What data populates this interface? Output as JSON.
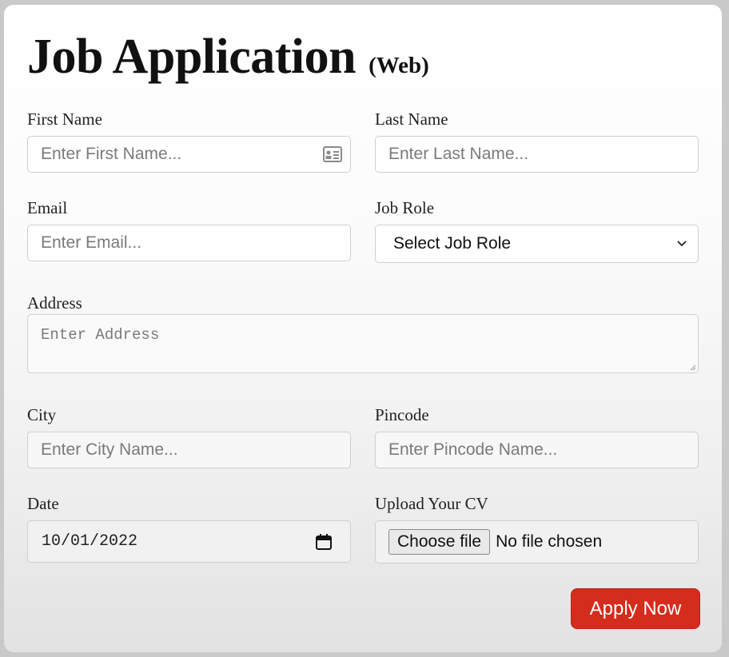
{
  "form": {
    "title": "Job Application",
    "subtitle": "(Web)",
    "first_name": {
      "label": "First Name",
      "placeholder": "Enter First Name..."
    },
    "last_name": {
      "label": "Last Name",
      "placeholder": "Enter Last Name..."
    },
    "email": {
      "label": "Email",
      "placeholder": "Enter Email..."
    },
    "job_role": {
      "label": "Job Role",
      "selected": "Select Job Role"
    },
    "address": {
      "label": "Address",
      "placeholder": "Enter Address"
    },
    "city": {
      "label": "City",
      "placeholder": "Enter City Name..."
    },
    "pincode": {
      "label": "Pincode",
      "placeholder": "Enter Pincode Name..."
    },
    "date": {
      "label": "Date",
      "value": "10/01/2022"
    },
    "cv": {
      "label": "Upload Your CV",
      "button": "Choose file",
      "status": "No file chosen"
    },
    "submit_label": "Apply Now"
  },
  "colors": {
    "accent": "#d42c1d",
    "field_border": "#cfcfcf"
  }
}
